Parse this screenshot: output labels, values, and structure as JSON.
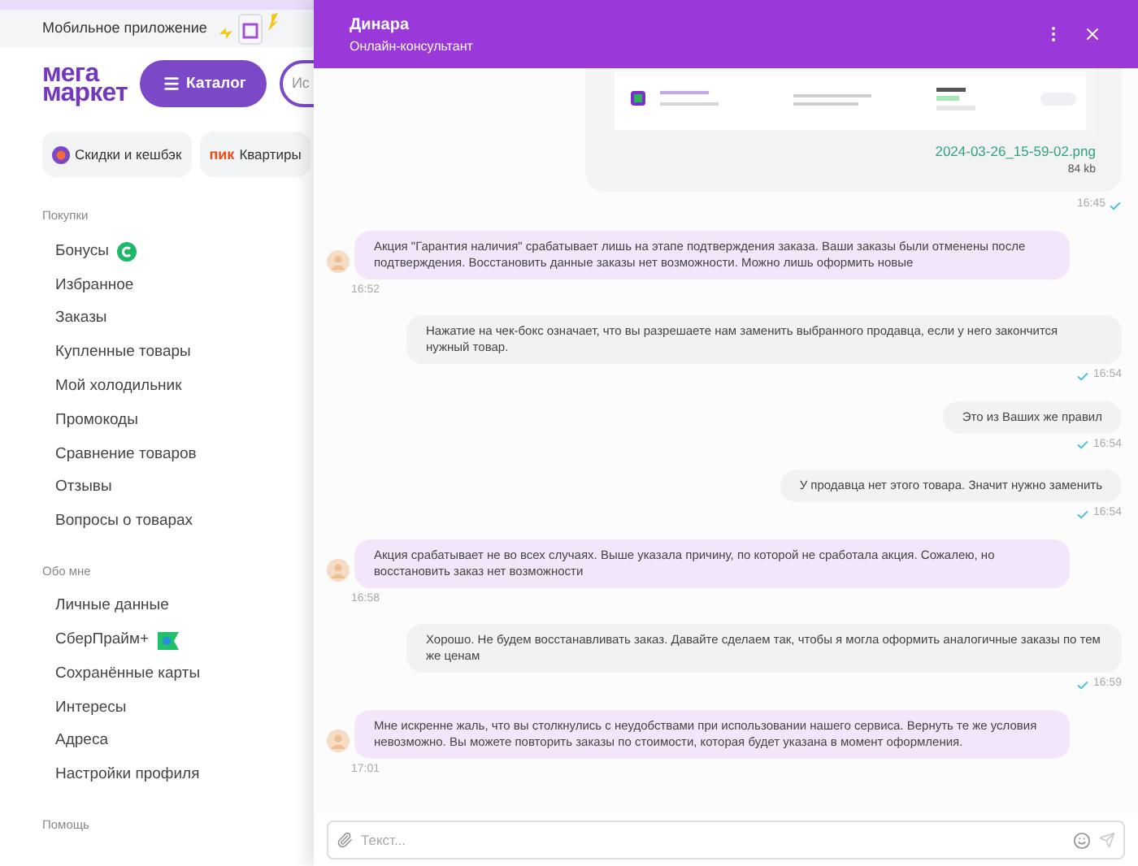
{
  "site": {
    "app_banner": "Мобильное приложение",
    "logo": [
      "мега",
      "маркет"
    ],
    "catalog_button": "Каталог",
    "search": {
      "placeholder": "Ис"
    },
    "chips": [
      {
        "label": "Скидки и кешбэк",
        "kind": "discount"
      },
      {
        "label": "Квартиры",
        "kind": "pik",
        "brand": "пик"
      }
    ]
  },
  "sidebar": {
    "sections": [
      {
        "title": "Покупки",
        "items": [
          {
            "label": "Бонусы",
            "kind": "bonus"
          },
          {
            "label": "Избранное"
          },
          {
            "label": "Заказы"
          },
          {
            "label": "Купленные товары"
          },
          {
            "label": "Мой холодильник"
          },
          {
            "label": "Промокоды"
          },
          {
            "label": "Сравнение товаров"
          },
          {
            "label": "Отзывы"
          },
          {
            "label": "Вопросы о товарах"
          }
        ]
      },
      {
        "title": "Обо мне",
        "items": [
          {
            "label": "Личные данные"
          },
          {
            "label": "СберПрайм+",
            "kind": "prime"
          },
          {
            "label": "Сохранённые карты"
          },
          {
            "label": "Интересы"
          },
          {
            "label": "Адреса"
          },
          {
            "label": "Настройки профиля"
          }
        ]
      },
      {
        "title": "Помощь"
      }
    ]
  },
  "chat": {
    "title": "Динара",
    "subtitle": "Онлайн-консультант",
    "input": {
      "placeholder": "Текст..."
    },
    "messages": [
      {
        "kind": "attachment",
        "file_name": "2024-03-26_15-59-02.png",
        "file_size": "84 kb",
        "time": "16:45",
        "delivered": true
      },
      {
        "kind": "agent",
        "text": "Акция \"Гарантия наличия\" срабатывает лишь на этапе подтверждения заказа. Ваши заказы были отменены после подтверждения. Восстановить данные заказы нет возможности. Можно лишь оформить новые",
        "time": "16:52"
      },
      {
        "kind": "user",
        "text": "Нажатие на чек-бокс означает, что вы разрешаете нам заменить выбранного продавца, если у него закончится нужный товар.",
        "time": "16:54",
        "delivered": true
      },
      {
        "kind": "user",
        "text": "Это из Ваших же правил",
        "time": "16:54",
        "delivered": true
      },
      {
        "kind": "user",
        "text": "У продавца нет этого товара. Значит нужно заменить",
        "time": "16:54",
        "delivered": true
      },
      {
        "kind": "agent",
        "text": "Акция срабатывает не во всех случаях. Выше указала причину, по которой не сработала акция. Сожалею, но восстановить заказ нет возможности",
        "time": "16:58"
      },
      {
        "kind": "user",
        "text": "Хорошо. Не будем восстанавливать заказ. Давайте сделаем так, чтобы я могла оформить аналогичные заказы по тем же ценам",
        "time": "16:59",
        "delivered": true
      },
      {
        "kind": "agent",
        "text": "Мне искренне жаль, что вы столкнулись с неудобствами при использовании нашего сервиса. Вернуть те же условия невозможно. Вы можете повторить заказы по стоимости, которая будет указана в момент оформления.",
        "time": "17:01"
      }
    ]
  }
}
